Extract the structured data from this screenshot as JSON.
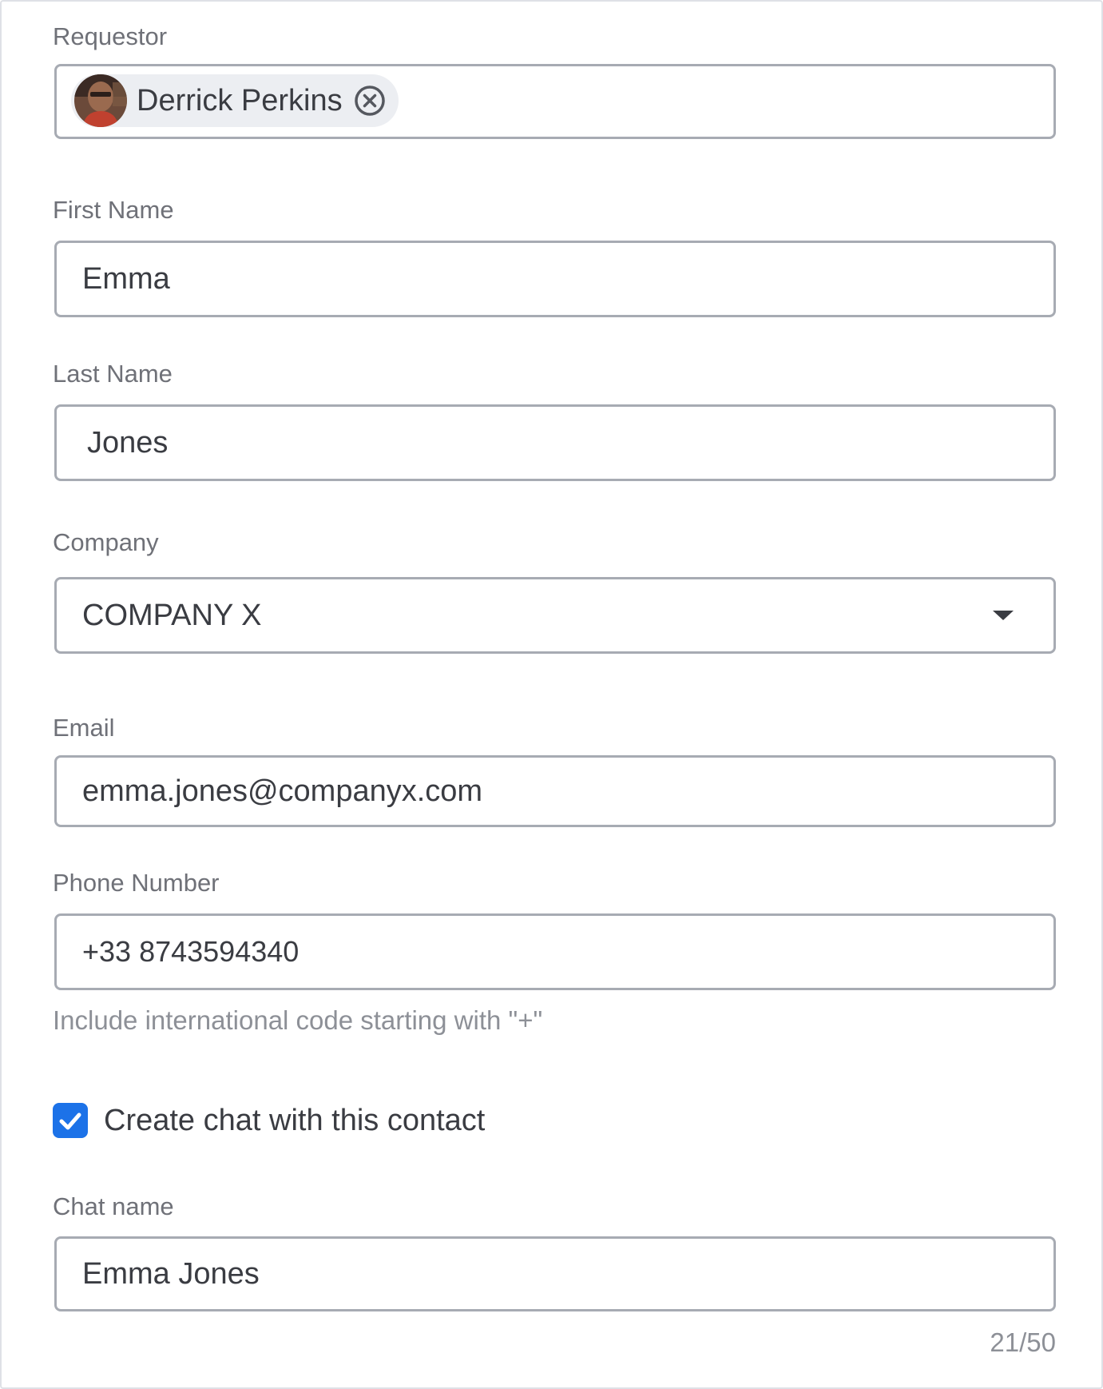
{
  "requestor": {
    "label": "Requestor",
    "chip_name": "Derrick Perkins",
    "avatar_icon": "user-avatar-photo",
    "remove_icon": "close-circle-icon"
  },
  "first_name": {
    "label": "First Name",
    "value": "Emma"
  },
  "last_name": {
    "label": "Last Name",
    "value": "Jones"
  },
  "company": {
    "label": "Company",
    "value": "COMPANY X",
    "arrow_icon": "caret-down-icon"
  },
  "email": {
    "label": "Email",
    "value": "emma.jones@companyx.com"
  },
  "phone": {
    "label": "Phone Number",
    "value": "+33 8743594340",
    "hint": "Include international code starting with \"+\""
  },
  "create_chat": {
    "label": "Create chat with this contact",
    "checked": true,
    "check_color": "#1c72e8"
  },
  "chat_name": {
    "label": "Chat name",
    "value": "Emma Jones",
    "counter": "21/50"
  },
  "colors": {
    "border": "#a7abb3",
    "label_text": "#6f7178",
    "value_text": "#3a3c42",
    "accent": "#1c72e8"
  }
}
